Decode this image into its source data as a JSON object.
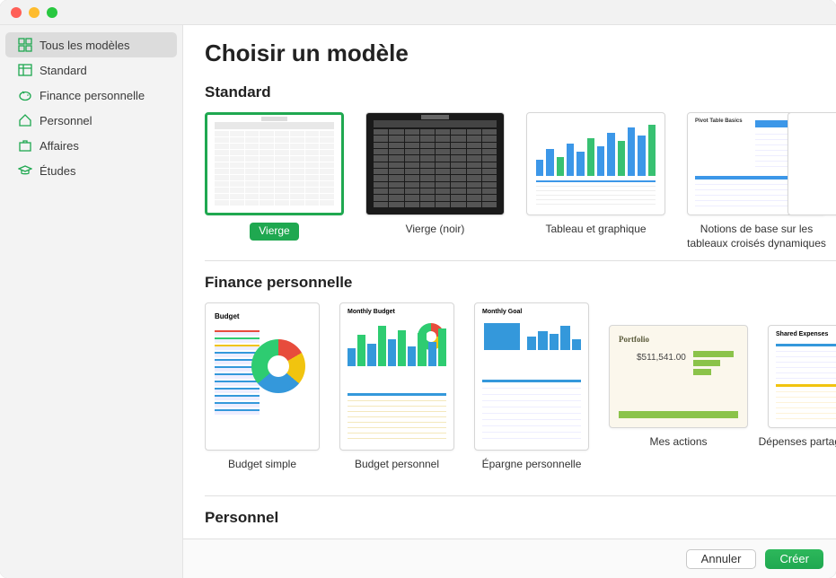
{
  "window": {
    "title": "Choisir un modèle"
  },
  "sidebar": {
    "items": [
      {
        "label": "Tous les modèles",
        "icon": "grid"
      },
      {
        "label": "Standard",
        "icon": "table"
      },
      {
        "label": "Finance personnelle",
        "icon": "piggy"
      },
      {
        "label": "Personnel",
        "icon": "home"
      },
      {
        "label": "Affaires",
        "icon": "briefcase"
      },
      {
        "label": "Études",
        "icon": "gradcap"
      }
    ],
    "selected_index": 0
  },
  "page_title": "Choisir un modèle",
  "sections": {
    "standard": {
      "header": "Standard",
      "templates": [
        {
          "label": "Vierge",
          "selected": true
        },
        {
          "label": "Vierge (noir)"
        },
        {
          "label": "Tableau et graphique"
        },
        {
          "label": "Notions de base sur les tableaux croisés dynamiques"
        }
      ]
    },
    "finance": {
      "header": "Finance personnelle",
      "templates": [
        {
          "label": "Budget simple",
          "thumb_title": "Budget"
        },
        {
          "label": "Budget personnel",
          "thumb_title": "Monthly Budget"
        },
        {
          "label": "Épargne personnelle",
          "thumb_title": "Monthly Goal"
        },
        {
          "label": "Mes actions",
          "thumb_title": "Portfolio",
          "thumb_amount": "$511,541.00"
        },
        {
          "label": "Dépenses partagées",
          "thumb_title": "Shared Expenses"
        }
      ]
    },
    "personnel": {
      "header": "Personnel"
    }
  },
  "footer": {
    "cancel": "Annuler",
    "create": "Créer"
  },
  "colors": {
    "accent": "#1fa850"
  },
  "pivot_title": "Pivot Table Basics"
}
